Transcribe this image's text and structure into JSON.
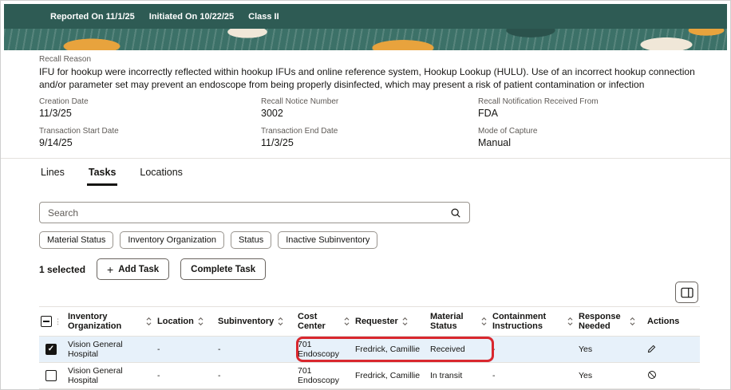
{
  "colors": {
    "header_bg": "#2E5B54",
    "banner_bg": "#3C7168",
    "banner_orange": "#E8A33D",
    "banner_cream": "#F0E7D8",
    "selected_row_bg": "#E7F1FA",
    "annotation_red": "#D9272E"
  },
  "topbar": {
    "items": [
      "Reported On 11/1/25",
      "Initiated On 10/22/25",
      "Class II"
    ]
  },
  "recall": {
    "reason_label": "Recall Reason",
    "reason_text": "IFU for hookup were incorrectly reflected within hookup IFUs and online reference system, Hookup Lookup (HULU). Use of an incorrect hookup connection and/or parameter set may prevent an endoscope from being properly disinfected, which may present a risk of patient contamination or infection",
    "fields": [
      {
        "label": "Creation Date",
        "value": "11/3/25"
      },
      {
        "label": "Recall Notice Number",
        "value": "3002"
      },
      {
        "label": "Recall Notification Received From",
        "value": "FDA"
      },
      {
        "label": "Transaction Start Date",
        "value": "9/14/25"
      },
      {
        "label": "Transaction End Date",
        "value": "11/3/25"
      },
      {
        "label": "Mode of Capture",
        "value": "Manual"
      }
    ]
  },
  "tabs": {
    "items": [
      {
        "label": "Lines"
      },
      {
        "label": "Tasks"
      },
      {
        "label": "Locations"
      }
    ],
    "active": "Tasks"
  },
  "search": {
    "placeholder": "Search"
  },
  "filters": {
    "chips": [
      "Material Status",
      "Inventory Organization",
      "Status",
      "Inactive Subinventory"
    ]
  },
  "toolbar": {
    "selected_count": "1 selected",
    "add_task_label": "Add Task",
    "complete_task_label": "Complete Task"
  },
  "table": {
    "columns": [
      "Inventory Organization",
      "Location",
      "Subinventory",
      "Cost Center",
      "Requester",
      "Material Status",
      "Containment Instructions",
      "Response Needed",
      "Actions"
    ],
    "rows": [
      {
        "checked": true,
        "inventory_organization": "Vision General Hospital",
        "location": "-",
        "subinventory": "-",
        "cost_center": "701 Endoscopy",
        "requester": "Fredrick, Camillie",
        "material_status": "Received",
        "containment_instructions": "-",
        "response_needed": "Yes",
        "action": "edit"
      },
      {
        "checked": false,
        "inventory_organization": "Vision General Hospital",
        "location": "-",
        "subinventory": "-",
        "cost_center": "701 Endoscopy",
        "requester": "Fredrick, Camillie",
        "material_status": "In transit",
        "containment_instructions": "-",
        "response_needed": "Yes",
        "action": "cancel"
      }
    ]
  },
  "icons": {
    "search": "magnifier",
    "sort": "up-down-chevrons",
    "add": "plus",
    "edit": "pencil",
    "cancel": "circle-slash",
    "column_manager": "split-table",
    "select_all": "indeterminate-checkbox"
  }
}
